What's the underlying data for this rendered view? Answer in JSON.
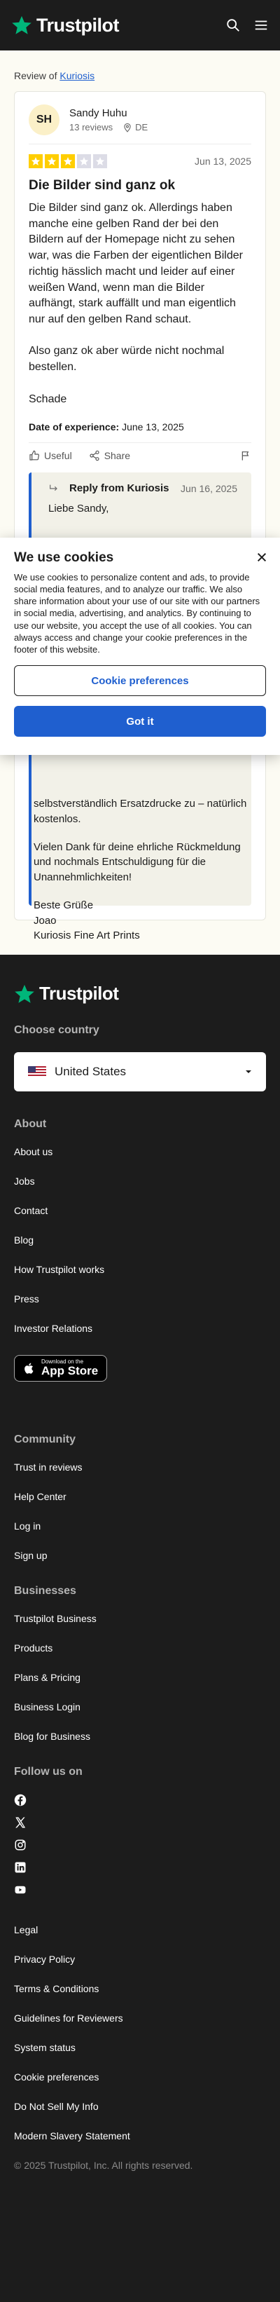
{
  "header": {
    "brand": "Trustpilot",
    "icons": [
      "search-icon",
      "menu-icon"
    ]
  },
  "colors": {
    "brand_green": "#00b67a",
    "star_yellow": "#ffce00",
    "link_blue": "#1f5fcf",
    "dark_bg": "#1c1c1c"
  },
  "review_of": {
    "prefix": "Review of ",
    "company": "Kuriosis"
  },
  "review": {
    "avatar_initials": "SH",
    "reviewer_name": "Sandy Huhu",
    "reviewer_reviews": "13 reviews",
    "reviewer_country": "DE",
    "rating": 3,
    "date": "Jun 13, 2025",
    "title": "Die Bilder sind ganz ok",
    "body": "Die Bilder sind ganz ok. Allerdings haben manche eine gelben Rand der bei den Bildern auf der Homepage nicht zu sehen war, was die Farben der eigentlichen Bilder richtig hässlich macht und leider auf einer weißen Wand, wenn man die Bilder aufhängt, stark auffällt und man eigentlich nur auf den gelben Rand schaut.\n\nAlso ganz ok aber würde nicht nochmal bestellen.\n\nSchade",
    "experience_label": "Date of experience:",
    "experience_date": "June 13, 2025",
    "useful_label": "Useful",
    "share_label": "Share"
  },
  "reply": {
    "from": "Reply from Kuriosis",
    "date": "Jun 16, 2025",
    "greeting": "Liebe Sandy,",
    "visible_fragment": "selbstverständlich Ersatzdrucke zu – natürlich kostenlos.",
    "thanks": "Vielen Dank für deine ehrliche Rückmeldung und nochmals Entschuldigung für die Unannehmlichkeiten!",
    "signoff": "Beste Grüße\nJoao\nKuriosis Fine Art Prints"
  },
  "cookie_banner": {
    "title": "We use cookies",
    "text": "We use cookies to personalize content and ads, to provide social media features, and to analyze our traffic. We also share information about your use of our site with our partners in social media, advertising, and analytics. By continuing to use our website, you accept the use of all cookies. You can always access and change your cookie preferences in the footer of this website.",
    "preferences_button": "Cookie preferences",
    "accept_button": "Got it"
  },
  "footer": {
    "brand": "Trustpilot",
    "choose_country_title": "Choose country",
    "country_selected": "United States",
    "about_title": "About",
    "about_links": [
      "About us",
      "Jobs",
      "Contact",
      "Blog",
      "How Trustpilot works",
      "Press",
      "Investor Relations"
    ],
    "app_store_small": "Download on the",
    "app_store_big": "App Store",
    "community_title": "Community",
    "community_links": [
      "Trust in reviews",
      "Help Center",
      "Log in",
      "Sign up"
    ],
    "businesses_title": "Businesses",
    "businesses_links": [
      "Trustpilot Business",
      "Products",
      "Plans & Pricing",
      "Business Login",
      "Blog for Business"
    ],
    "follow_title": "Follow us on",
    "social_icons": [
      "facebook-icon",
      "x-icon",
      "instagram-icon",
      "linkedin-icon",
      "youtube-icon"
    ],
    "legal_links": [
      "Legal",
      "Privacy Policy",
      "Terms & Conditions",
      "Guidelines for Reviewers",
      "System status",
      "Cookie preferences",
      "Do Not Sell My Info",
      "Modern Slavery Statement"
    ],
    "copyright": "© 2025 Trustpilot, Inc. All rights reserved."
  }
}
